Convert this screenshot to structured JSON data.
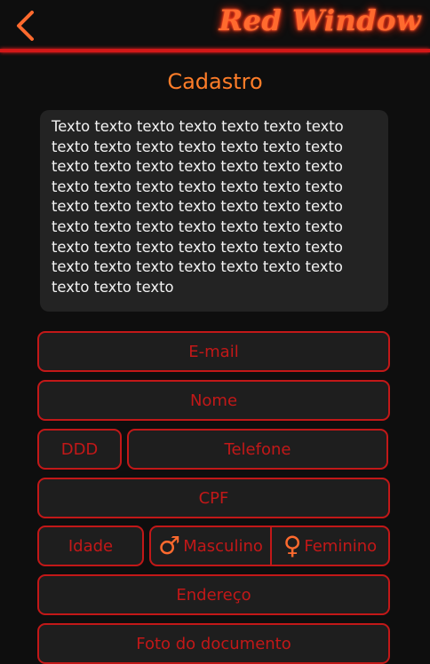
{
  "header": {
    "brand": "Red Window"
  },
  "page": {
    "title": "Cadastro"
  },
  "info_text": "Texto texto texto texto texto texto texto texto texto texto texto texto texto texto texto texto texto texto texto texto texto texto texto texto texto texto texto texto texto texto texto texto texto texto texto texto texto texto texto texto texto texto texto texto texto texto texto texto texto texto texto texto texto texto texto texto texto texto texto",
  "form": {
    "email": "E-mail",
    "name": "Nome",
    "ddd": "DDD",
    "phone": "Telefone",
    "cpf": "CPF",
    "age": "Idade",
    "male": "Masculino",
    "female": "Feminino",
    "address": "Endereço",
    "document_photo": "Foto do documento"
  },
  "colors": {
    "accent": "#c21818",
    "brand": "#ff6a2e",
    "title": "#ff7d29"
  },
  "icons": {
    "back": "chevron-left-icon",
    "male": "male-icon",
    "female": "female-icon"
  }
}
